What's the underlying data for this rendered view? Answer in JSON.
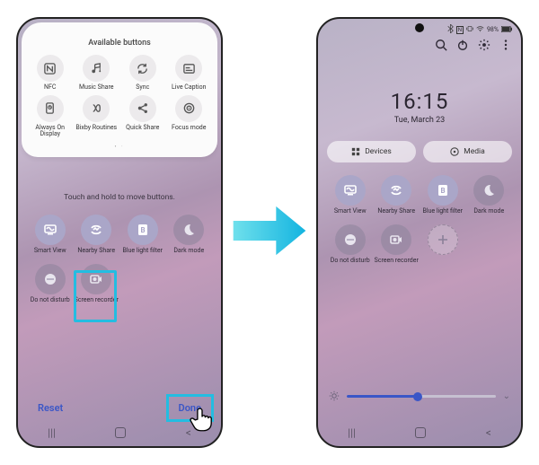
{
  "left": {
    "available_title": "Available buttons",
    "available": [
      {
        "name": "nfc",
        "label": "NFC"
      },
      {
        "name": "music-share",
        "label": "Music Share"
      },
      {
        "name": "sync",
        "label": "Sync"
      },
      {
        "name": "live-caption",
        "label": "Live Caption"
      },
      {
        "name": "aod",
        "label": "Always On Display"
      },
      {
        "name": "bixby",
        "label": "Bixby Routines"
      },
      {
        "name": "quick-share",
        "label": "Quick Share"
      },
      {
        "name": "focus",
        "label": "Focus mode"
      }
    ],
    "hint": "Touch and hold to move buttons.",
    "quick": [
      {
        "name": "smart-view",
        "label": "Smart View",
        "state": "on"
      },
      {
        "name": "nearby-share",
        "label": "Nearby Share",
        "state": "on"
      },
      {
        "name": "blue-light",
        "label": "Blue light filter",
        "state": "on"
      },
      {
        "name": "dark-mode",
        "label": "Dark mode",
        "state": "off"
      },
      {
        "name": "dnd",
        "label": "Do not disturb",
        "state": "off"
      },
      {
        "name": "screen-recorder",
        "label": "Screen recorder",
        "state": "off",
        "highlight": true
      }
    ],
    "reset_label": "Reset",
    "done_label": "Done"
  },
  "right": {
    "status": {
      "battery": "98%",
      "bt": true,
      "vibrate": true,
      "wifi": true,
      "nfc": true
    },
    "clock": {
      "time": "16:15",
      "date": "Tue, March 23"
    },
    "pills": {
      "devices": "Devices",
      "media": "Media"
    },
    "quick": [
      {
        "name": "smart-view",
        "label": "Smart View",
        "state": "on"
      },
      {
        "name": "nearby-share",
        "label": "Nearby Share",
        "state": "on"
      },
      {
        "name": "blue-light",
        "label": "Blue light filter",
        "state": "on"
      },
      {
        "name": "dark-mode",
        "label": "Dark mode",
        "state": "off"
      },
      {
        "name": "dnd",
        "label": "Do not disturb",
        "state": "off"
      },
      {
        "name": "screen-recorder",
        "label": "Screen recorder",
        "state": "off"
      },
      {
        "name": "add",
        "label": "",
        "state": "add"
      }
    ],
    "brightness_pct": 48
  },
  "colors": {
    "accent": "#3a56c7",
    "highlight": "#23bde1"
  }
}
